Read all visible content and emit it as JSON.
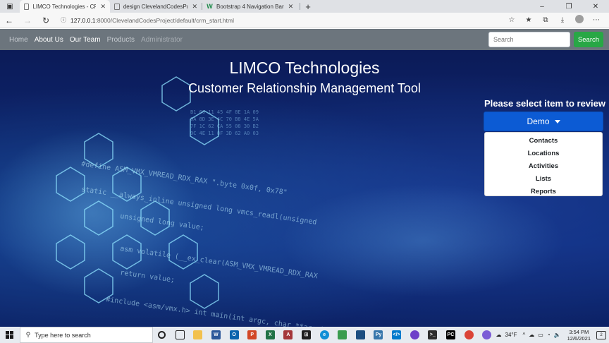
{
  "browser": {
    "tabs": [
      {
        "title": "LIMCO Technologies - CRM Tool",
        "active": true,
        "icon": "page-icon"
      },
      {
        "title": "design ClevelandCodesProject",
        "active": false,
        "icon": "page-icon"
      },
      {
        "title": "Bootstrap 4 Navigation Bar",
        "active": false,
        "icon": "w3schools-icon"
      }
    ],
    "url_host": "127.0.0.1",
    "url_path": ":8000/ClevelandCodesProject/default/crm_start.html"
  },
  "navbar": {
    "links": [
      "Home",
      "About Us",
      "Our Team",
      "Products",
      "Administrator"
    ],
    "search_placeholder": "Search",
    "search_button": "Search"
  },
  "hero": {
    "title": "LIMCO Technologies",
    "subtitle": "Customer Relationship Management Tool",
    "prompt": "Please select item to review",
    "dropdown_label": "Demo",
    "menu_items": [
      "Contacts",
      "Locations",
      "Activities",
      "Lists",
      "Reports"
    ]
  },
  "taskbar": {
    "search_placeholder": "Type here to search",
    "temperature": "34°F",
    "time": "3:54 PM",
    "date": "12/6/2021",
    "notifications": "2"
  },
  "colors": {
    "navbar": "#6c757d",
    "search_button": "#28a745",
    "demo_button": "#0c5bd4"
  }
}
